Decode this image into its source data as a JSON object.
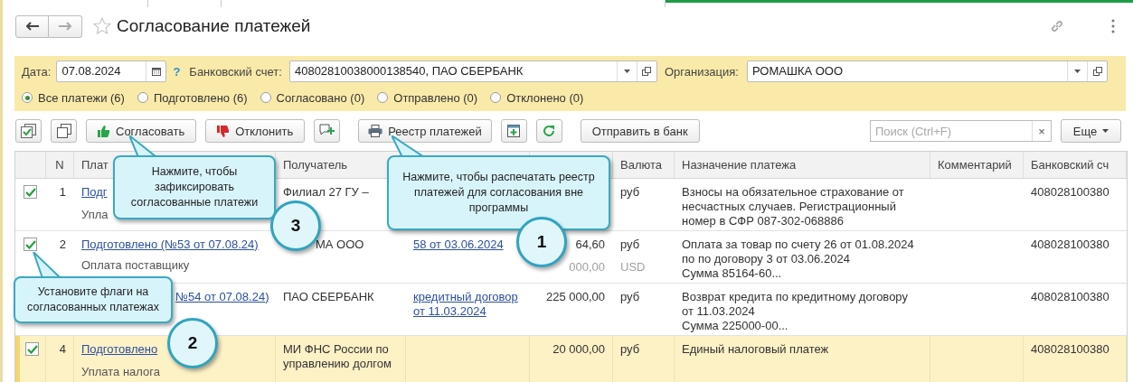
{
  "header": {
    "title": "Согласование платежей",
    "favorite": false
  },
  "filters": {
    "date_label": "Дата:",
    "date": "07.08.2024",
    "help": "?",
    "account_label": "Банковский счет:",
    "account": "40802810038000138540, ПАО СБЕРБАНК",
    "organization_label": "Организация:",
    "organization": "РОМАШКА ООО"
  },
  "status_filter": [
    {
      "label": "Все платежи (6)",
      "selected": true
    },
    {
      "label": "Подготовлено (6)",
      "selected": false
    },
    {
      "label": "Согласовано (0)",
      "selected": false
    },
    {
      "label": "Отправлено (0)",
      "selected": false
    },
    {
      "label": "Отклонено (0)",
      "selected": false
    }
  ],
  "toolbar": {
    "buttons": [
      {
        "kind": "check_all"
      },
      {
        "kind": "copy"
      },
      {
        "kind": "approve",
        "label": "Согласовать"
      },
      {
        "kind": "reject",
        "label": "Отклонить"
      },
      {
        "kind": "comment"
      },
      {
        "kind": "registry",
        "label": "Реестр платежей"
      },
      {
        "kind": "add"
      },
      {
        "kind": "refresh"
      },
      {
        "kind": "send",
        "label": "Отправить в банк"
      }
    ],
    "search": {
      "placeholder": "Поиск (Ctrl+F)",
      "clear": "×"
    },
    "more": "Еще"
  },
  "table": {
    "header": {
      "number": "N",
      "payment": "Плат",
      "recipient": "Получатель",
      "currency": "Валюта",
      "purpose": "Назначение платежа",
      "comment": "Комментарий",
      "account": "Банковский сч"
    },
    "rows": [
      {
        "checked": true,
        "number": "1",
        "payment": "Подг",
        "payment_note": "Упла",
        "recipient": "Филиал 27 ГУ –",
        "currency": "руб",
        "purpose": "Взносы на обязательное страхование от\nнесчастных случаев. Регистрационный\nномер в СФР 087-302-068886",
        "account": "408028100380",
        "selected": false
      },
      {
        "checked": true,
        "number": "2",
        "payment": "Подготовлено (№53 от 07.08.24)",
        "payment_note": "Оплата поставщику",
        "recipient": "МА ООО",
        "basis": "58 от 03.06.2024",
        "amount": "64,60",
        "amount_2": "000,00",
        "currency": "руб",
        "currency_2": "USD",
        "purpose": "Оплата за товар по счету 26 от 01.08.2024\nпо по договору 3 от 03.06.2024\nСумма 85164-60...",
        "account": "408028100380",
        "selected": false
      },
      {
        "payment": "№54 от 07.08.24)",
        "recipient": "ПАО СБЕРБАНК",
        "basis": "кредитный договор от 11.03.2024",
        "amount": "225 000,00",
        "currency": "руб",
        "purpose": "Возврат кредита по кредитному договору\nот 11.03.2024\nСумма 225000-00...",
        "account": "408028100380",
        "selected": false
      },
      {
        "checked": true,
        "number": "4",
        "payment": "Подготовлено",
        "payment_note": "Уплата налога",
        "recipient": "МИ ФНС России по управлению долгом",
        "amount": "20 000,00",
        "currency": "руб",
        "purpose": "Единый налоговый платеж",
        "account": "408028100380",
        "selected": true
      }
    ]
  },
  "callouts": [
    {
      "text": "Нажмите, чтобы зафиксировать согласованные платежи",
      "badge": "3"
    },
    {
      "text": "Нажмите, чтобы распечатать реестр платежей для согласования вне программы",
      "badge": "1"
    },
    {
      "text": "Установите флаги на согласованных платежах",
      "badge": "2"
    }
  ]
}
